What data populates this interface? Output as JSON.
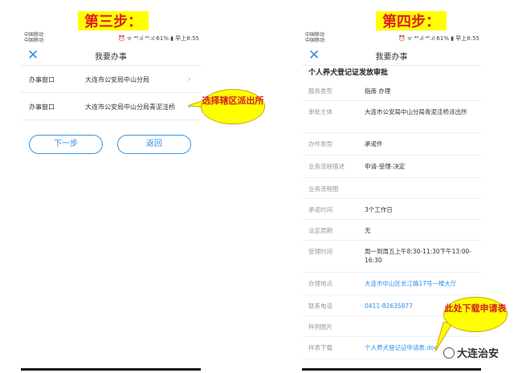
{
  "left": {
    "step_label": "第三步：",
    "status": {
      "carrier1": "中国移动",
      "carrier2": "中国移动",
      "right": "⏰ ᯤ ⁴⁶.ıl ⁴⁶.ıl 61% ▮ 早上8:55"
    },
    "nav": {
      "close": "✕",
      "title": "我要办事"
    },
    "rows": [
      {
        "label": "办事窗口",
        "value": "大连市公安局中山分局",
        "chevron": "›"
      },
      {
        "label": "办事窗口",
        "value": "大连市公安局中山分局青泥洼桥",
        "chevron": "›"
      }
    ],
    "next_label": "下一步",
    "back_label": "返回",
    "callout": "选择辖区派出所"
  },
  "right": {
    "step_label": "第四步：",
    "status": {
      "carrier1": "中国移动",
      "carrier2": "中国移动",
      "right": "⏰ ᯤ ⁴⁶.ıl ⁴⁶.ıl 61% ▮ 早上8:55"
    },
    "nav": {
      "close": "✕",
      "title": "我要办事"
    },
    "detail_title": "个人养犬登记证发放审批",
    "rows": [
      {
        "label": "服务类型",
        "value": "指南 办理"
      },
      {
        "label": "审批主体",
        "value": "大连市公安局中山分局青泥洼桥派出所"
      },
      {
        "label": "办件类型",
        "value": "承诺件"
      },
      {
        "label": "业务流程描述",
        "value": "申请-受理-决定"
      },
      {
        "label": "业务流程图",
        "value": ""
      },
      {
        "label": "承诺时间",
        "value": "3个工作日"
      },
      {
        "label": "法定周期",
        "value": "无"
      },
      {
        "label": "受理时间",
        "value": "周一到周五上午8:30-11:30下午13:00-16:30"
      },
      {
        "label": "办理地点",
        "value": "大连市中山区长江路17号一楼大厅"
      },
      {
        "label": "联系电话",
        "value": "0411-82635877"
      },
      {
        "label": "样例图片",
        "value": ""
      },
      {
        "label": "样表下载",
        "value": "个人养犬登记证申请表.doc"
      }
    ],
    "callout": "此处下载申请表",
    "watermark": "大连治安"
  }
}
